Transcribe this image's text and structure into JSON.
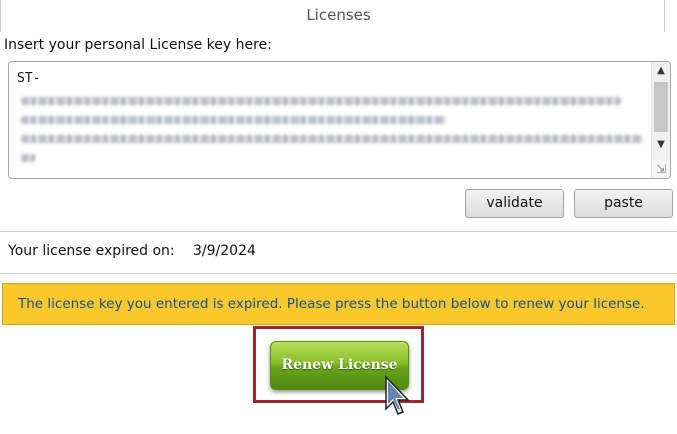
{
  "header": {
    "title": "Licenses"
  },
  "license_input": {
    "label": "Insert your personal License key here:",
    "value_visible_prefix": "ST-"
  },
  "buttons": {
    "validate": "validate",
    "paste": "paste",
    "renew": "Renew License"
  },
  "expiration": {
    "label": "Your license expired on:",
    "date": "3/9/2024"
  },
  "warning": {
    "message": "The license key you entered is expired. Please press the button below to renew your license."
  },
  "colors": {
    "warning_bg": "#f9c92b",
    "warning_text": "#1b4f8a",
    "renew_green": "#6aa31a",
    "highlight_frame": "#a3252c"
  },
  "icons": {
    "scroll_up": "chevron-up-icon",
    "scroll_down": "chevron-down-icon",
    "resize": "resize-grip-icon",
    "cursor": "mouse-pointer-icon"
  }
}
